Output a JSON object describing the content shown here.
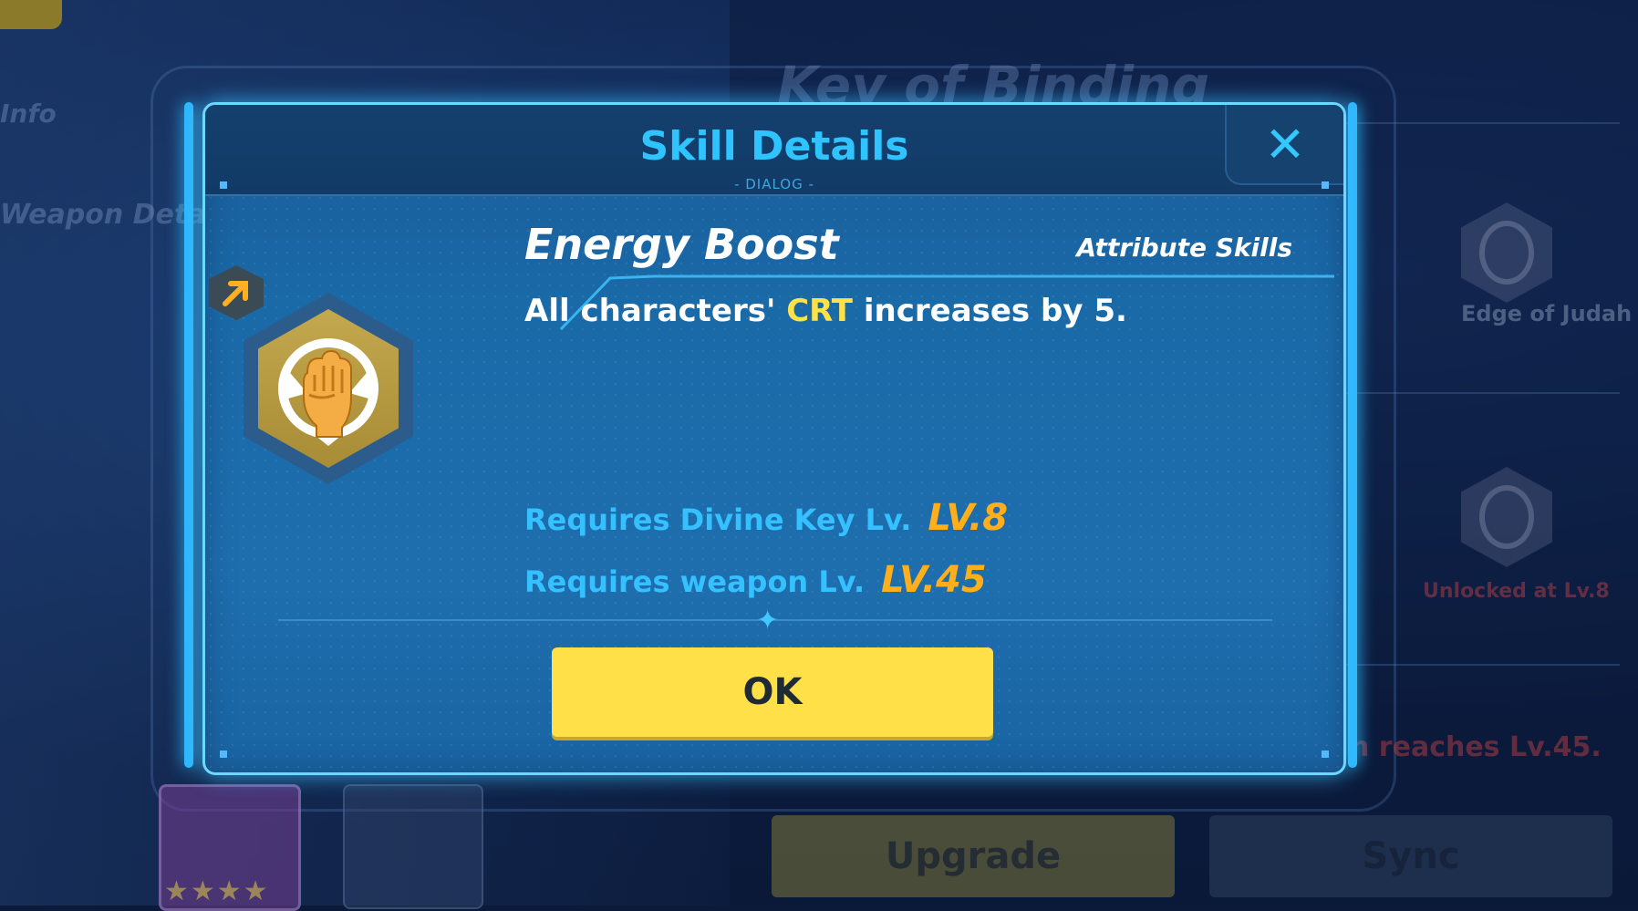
{
  "background": {
    "info_label": "Info",
    "weapon_details_label": "Weapon Details",
    "weapon_title": "Key of Binding",
    "skill_name": "Edge of Judah II",
    "unlock_text": "Unlocked at Lv.8",
    "condition_text": "n reaches Lv.45.",
    "upgrade_label": "Upgrade",
    "sync_label": "Sync",
    "stars": "★★★★"
  },
  "dialog": {
    "title": "Skill Details",
    "subtitle": "- DIALOG -",
    "close_glyph": "✕",
    "skill": {
      "name": "Energy Boost",
      "type": "Attribute Skills",
      "icon": "fist-icon",
      "badge_icon": "arrow-up-right-icon",
      "desc_prefix": "All characters' ",
      "desc_highlight": "CRT",
      "desc_suffix": " increases by 5."
    },
    "requirements": [
      {
        "label": "Requires Divine Key Lv.",
        "value": "LV.8"
      },
      {
        "label": "Requires weapon Lv.",
        "value": "LV.45"
      }
    ],
    "ok_label": "OK"
  },
  "colors": {
    "accent": "#2fc4ff",
    "highlight": "#ffe14a",
    "level": "#ffae1c",
    "button": "#ffe048"
  }
}
